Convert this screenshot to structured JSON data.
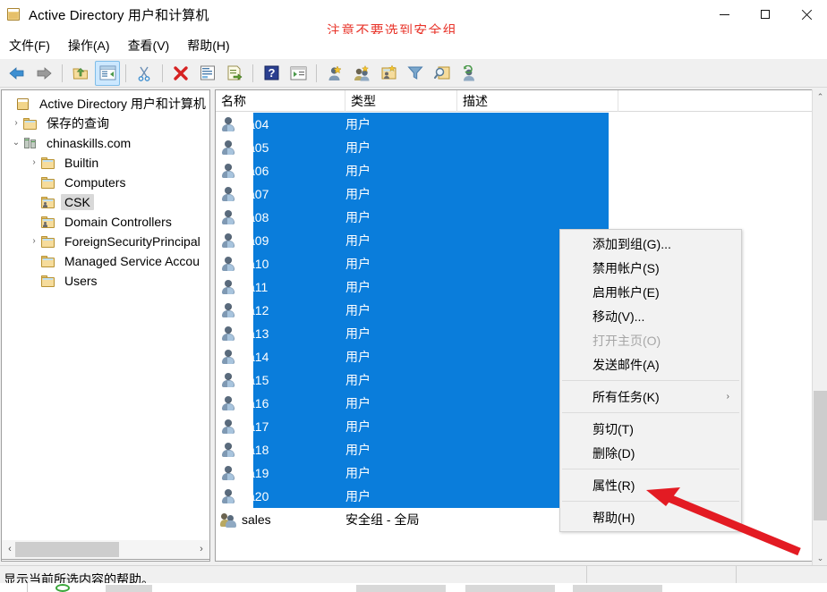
{
  "window": {
    "title": "Active Directory 用户和计算机",
    "icon": "console-icon",
    "buttons": {
      "minimize": "−",
      "maximize": "□",
      "close": "✕"
    }
  },
  "annotation": {
    "note_text": "注意不要选到安全组",
    "note_color": "#e8342a",
    "arrow_color": "#e31b23"
  },
  "menubar": {
    "items": [
      {
        "label": "文件(F)",
        "name": "menu-file"
      },
      {
        "label": "操作(A)",
        "name": "menu-action"
      },
      {
        "label": "查看(V)",
        "name": "menu-view"
      },
      {
        "label": "帮助(H)",
        "name": "menu-help"
      }
    ]
  },
  "toolbar": {
    "buttons": [
      {
        "name": "back-icon",
        "glyph": "◀"
      },
      {
        "name": "forward-icon",
        "glyph": "▶"
      },
      {
        "name": "up-one-level-icon",
        "glyph": "↑"
      },
      {
        "name": "show-hide-console-tree-icon",
        "glyph": "▤",
        "active": true
      },
      {
        "name": "cut-icon",
        "glyph": "✂"
      },
      {
        "name": "delete-icon",
        "glyph": "✖"
      },
      {
        "name": "properties-icon",
        "glyph": "▤"
      },
      {
        "name": "export-list-icon",
        "glyph": "▤"
      },
      {
        "name": "help-icon",
        "glyph": "?"
      },
      {
        "name": "run-console-icon",
        "glyph": "▶"
      },
      {
        "name": "new-user-icon",
        "glyph": "👤"
      },
      {
        "name": "new-group-icon",
        "glyph": "👥"
      },
      {
        "name": "new-ou-icon",
        "glyph": "📁"
      },
      {
        "name": "filter-icon",
        "glyph": "▽"
      },
      {
        "name": "find-icon",
        "glyph": "🔍"
      },
      {
        "name": "saved-query-icon",
        "glyph": "👤"
      }
    ]
  },
  "tree": {
    "nodes": [
      {
        "label": "Active Directory 用户和计算机 [",
        "indent": 0,
        "twisty": "",
        "icon": "console-icon",
        "selected": false
      },
      {
        "label": "保存的查询",
        "indent": 1,
        "twisty": "›",
        "icon": "folder-icon",
        "selected": false
      },
      {
        "label": "chinaskills.com",
        "indent": 1,
        "twisty": "⌄",
        "icon": "domain-icon",
        "selected": false
      },
      {
        "label": "Builtin",
        "indent": 2,
        "twisty": "›",
        "icon": "folder-icon",
        "selected": false
      },
      {
        "label": "Computers",
        "indent": 2,
        "twisty": "",
        "icon": "folder-icon",
        "selected": false
      },
      {
        "label": "CSK",
        "indent": 2,
        "twisty": "",
        "icon": "ou-folder-icon",
        "selected": true
      },
      {
        "label": "Domain Controllers",
        "indent": 2,
        "twisty": "",
        "icon": "ou-folder-icon",
        "selected": false
      },
      {
        "label": "ForeignSecurityPrincipal",
        "indent": 2,
        "twisty": "›",
        "icon": "folder-icon",
        "selected": false
      },
      {
        "label": "Managed Service Accou",
        "indent": 2,
        "twisty": "",
        "icon": "folder-icon",
        "selected": false
      },
      {
        "label": "Users",
        "indent": 2,
        "twisty": "",
        "icon": "folder-icon",
        "selected": false
      }
    ]
  },
  "list": {
    "columns": [
      {
        "label": "名称",
        "name": "column-name"
      },
      {
        "label": "类型",
        "name": "column-type"
      },
      {
        "label": "描述",
        "name": "column-description"
      }
    ],
    "rows": [
      {
        "name": "sa04",
        "type": "用户",
        "desc": "",
        "icon": "user-icon",
        "selected": true
      },
      {
        "name": "sa05",
        "type": "用户",
        "desc": "",
        "icon": "user-icon",
        "selected": true
      },
      {
        "name": "sa06",
        "type": "用户",
        "desc": "",
        "icon": "user-icon",
        "selected": true
      },
      {
        "name": "sa07",
        "type": "用户",
        "desc": "",
        "icon": "user-icon",
        "selected": true
      },
      {
        "name": "sa08",
        "type": "用户",
        "desc": "",
        "icon": "user-icon",
        "selected": true
      },
      {
        "name": "sa09",
        "type": "用户",
        "desc": "",
        "icon": "user-icon",
        "selected": true
      },
      {
        "name": "sa10",
        "type": "用户",
        "desc": "",
        "icon": "user-icon",
        "selected": true
      },
      {
        "name": "sa11",
        "type": "用户",
        "desc": "",
        "icon": "user-icon",
        "selected": true
      },
      {
        "name": "sa12",
        "type": "用户",
        "desc": "",
        "icon": "user-icon",
        "selected": true
      },
      {
        "name": "sa13",
        "type": "用户",
        "desc": "",
        "icon": "user-icon",
        "selected": true
      },
      {
        "name": "sa14",
        "type": "用户",
        "desc": "",
        "icon": "user-icon",
        "selected": true
      },
      {
        "name": "sa15",
        "type": "用户",
        "desc": "",
        "icon": "user-icon",
        "selected": true
      },
      {
        "name": "sa16",
        "type": "用户",
        "desc": "",
        "icon": "user-icon",
        "selected": true
      },
      {
        "name": "sa17",
        "type": "用户",
        "desc": "",
        "icon": "user-icon",
        "selected": true
      },
      {
        "name": "sa18",
        "type": "用户",
        "desc": "",
        "icon": "user-icon",
        "selected": true
      },
      {
        "name": "sa19",
        "type": "用户",
        "desc": "",
        "icon": "user-icon",
        "selected": true
      },
      {
        "name": "sa20",
        "type": "用户",
        "desc": "",
        "icon": "user-icon",
        "selected": true
      },
      {
        "name": "sales",
        "type": "安全组 - 全局",
        "desc": "",
        "icon": "group-icon",
        "selected": false
      }
    ],
    "selection_color": "#0a7ddb"
  },
  "context_menu": {
    "items": [
      {
        "label": "添加到组(G)...",
        "name": "ctx-add-to-group",
        "disabled": false,
        "submenu": false
      },
      {
        "label": "禁用帐户(S)",
        "name": "ctx-disable-account",
        "disabled": false,
        "submenu": false
      },
      {
        "label": "启用帐户(E)",
        "name": "ctx-enable-account",
        "disabled": false,
        "submenu": false
      },
      {
        "label": "移动(V)...",
        "name": "ctx-move",
        "disabled": false,
        "submenu": false
      },
      {
        "label": "打开主页(O)",
        "name": "ctx-open-home-page",
        "disabled": true,
        "submenu": false
      },
      {
        "label": "发送邮件(A)",
        "name": "ctx-send-mail",
        "disabled": false,
        "submenu": false
      },
      {
        "separator": true
      },
      {
        "label": "所有任务(K)",
        "name": "ctx-all-tasks",
        "disabled": false,
        "submenu": true
      },
      {
        "separator": true
      },
      {
        "label": "剪切(T)",
        "name": "ctx-cut",
        "disabled": false,
        "submenu": false
      },
      {
        "label": "删除(D)",
        "name": "ctx-delete",
        "disabled": false,
        "submenu": false
      },
      {
        "separator": true
      },
      {
        "label": "属性(R)",
        "name": "ctx-properties",
        "disabled": false,
        "submenu": false
      },
      {
        "separator": true
      },
      {
        "label": "帮助(H)",
        "name": "ctx-help",
        "disabled": false,
        "submenu": false
      }
    ],
    "submenu_glyph": "›"
  },
  "statusbar": {
    "text": "显示当前所选内容的帮助。"
  },
  "scrollbars": {
    "vertical_up_glyph": "⌃",
    "vertical_down_glyph": "⌄",
    "horizontal_left_glyph": "‹",
    "horizontal_right_glyph": "›"
  }
}
